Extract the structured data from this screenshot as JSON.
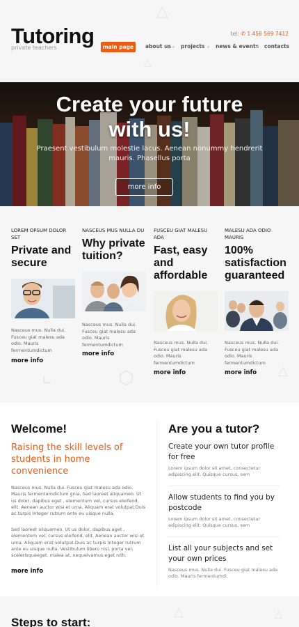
{
  "header": {
    "logo": "Tutoring",
    "tagline": "private teachers",
    "phone_label": "tel:",
    "phone_number": "1 456 569 7412",
    "phone_icon": "phone-icon"
  },
  "nav": {
    "active": "main page",
    "items": [
      "about us",
      "projects",
      "news & events",
      "contacts"
    ]
  },
  "hero": {
    "title_line1": "Create your future",
    "title_line2": "with us!",
    "text": "Praesent vestibulum molestie lacus. Aenean nonummy hendrerit mauris. Phasellus porta",
    "button": "more info"
  },
  "features": [
    {
      "kicker": "LOREM OPSUM DOLOR SET",
      "title": "Private and secure",
      "text": "Nasceus mus. Nulla dui. Fusceu giat malesu ada odio. Mauris fermentumdictum",
      "more": "more info"
    },
    {
      "kicker": "NASCEUS MUS NULLA DU",
      "title": "Why private tuition?",
      "text": "Nasceus mus. Nulla dui. Fusceu giat malesu ada odio. Mauris fermentumdictum",
      "more": "more info"
    },
    {
      "kicker": "FUSCEU GIAT MALESU ADA",
      "title": "Fast, easy and affordable",
      "text": "Nasceus mus. Nulla dui. Fusceu giat malesu ada odio. Mauris fermentumdictum",
      "more": "more info"
    },
    {
      "kicker": "MALESU ADA ODIO MAURIS",
      "title": "100% satisfaction guaranteed",
      "text": "Nasceus mus. Nulla dui. Fusceu giat malesu ada odio. Mauris fermentumdictum",
      "more": "more info"
    }
  ],
  "welcome": {
    "heading": "Welcome!",
    "subheading": "Raising the skill levels of students in home convenience",
    "para1": "Nasceus mus. Nulla dui. Fusceu giat malesu ada odio. Mauris fermentumdictum gnia. Sed laoreet aliquameo. Ut us dolor, dapibus eget , elementum vel, cursus eleifend, elit. Aenean auctor wisi et urna. Aliquam erat volutpat.Duis ac turpis Integer rutrum ante eu uisque nulla.",
    "para2": "Sed laoreet aliquameo. Ut us dolor, dapibus eget , elementum vel, cursus eleifend, elit. Aenean auctor wisi et urna. Aliquam erat volutpat.Duis ac turpis Integer rutrum ante eu uisque nulla. Vestibulum libero nisl, porta vel, scelerisqueeget. malea at, nequelvamus eget nith.",
    "more": "more info"
  },
  "tutor": {
    "heading": "Are you a tutor?",
    "items": [
      {
        "title": "Create your own tutor profile for free",
        "text": "Lorem ipsum dolor sit amet, consectetur adipiscing elit. Quisque cursus, sem"
      },
      {
        "title": "Allow students to find you by postcode",
        "text": "Lorem ipsum dolor sit amet, consectetur adipiscing elit. Quisque cursus, sem"
      },
      {
        "title": "List all your subjects and set your own prices",
        "text": "Nasceus mus. Nulla dui. Fusceu giat malesu ada odio. Mauris fermentumdi."
      }
    ]
  },
  "steps": {
    "heading": "Steps to start:"
  },
  "colors": {
    "accent": "#e85c14",
    "background": "#f6f6f6"
  }
}
